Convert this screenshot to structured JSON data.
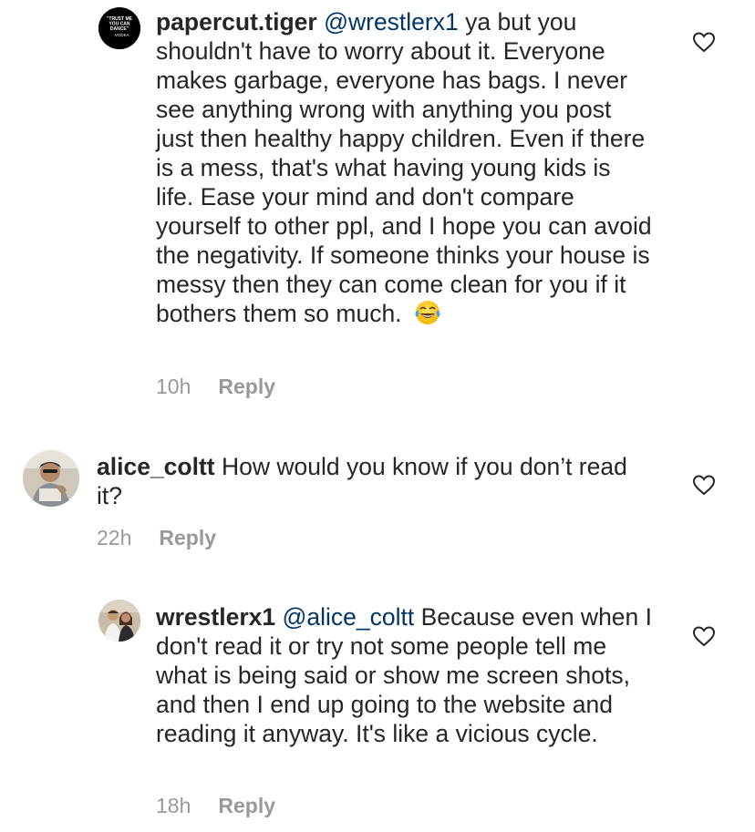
{
  "comments": [
    {
      "username": "papercut.tiger",
      "mention": "@wrestlerx1",
      "text": " ya but you shouldn't have to worry about it.  Everyone makes garbage,  everyone has bags.  I never see anything wrong with anything you post just then healthy happy children.  Even if there is a mess,  that's what having young kids is life.  Ease your mind and don't compare yourself to other ppl, and I hope you can avoid the negativity. If someone thinks your house is messy then they can come clean for you if it bothers them so much.",
      "emoji": "face-with-tears-of-joy",
      "time": "10h",
      "reply": "Reply",
      "avatar_text": [
        "\"TRUST ME",
        "YOU CAN",
        "DANCE\"",
        "-VODKA"
      ]
    },
    {
      "username": "alice_coltt",
      "mention": "",
      "text": " How would you know if you don’t read it?",
      "time": "22h",
      "reply": "Reply"
    },
    {
      "username": "wrestlerx1",
      "mention": "@alice_coltt",
      "text": " Because even when I don't read it or try not some people tell me what is being said or show me screen shots, and then I end up going to the website and reading it anyway. It's like a vicious cycle.",
      "time": "18h",
      "reply": "Reply"
    }
  ],
  "icons": {
    "like": "heart-outline-icon"
  },
  "colors": {
    "text": "#262626",
    "mention": "#003569",
    "meta": "#999999"
  }
}
